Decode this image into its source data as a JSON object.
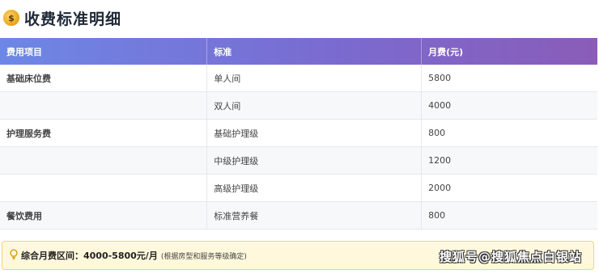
{
  "header": {
    "icon": "money-bag-icon",
    "icon_glyph": "$",
    "title": "收费标准明细"
  },
  "table": {
    "columns": [
      "费用项目",
      "标准",
      "月费(元)"
    ],
    "rows": [
      {
        "category": "基础床位费",
        "standard": "单人间",
        "fee": "5800"
      },
      {
        "category": "",
        "standard": "双人间",
        "fee": "4000"
      },
      {
        "category": "护理服务费",
        "standard": "基础护理级",
        "fee": "800"
      },
      {
        "category": "",
        "standard": "中级护理级",
        "fee": "1200"
      },
      {
        "category": "",
        "standard": "高级护理级",
        "fee": "2000"
      },
      {
        "category": "餐饮费用",
        "standard": "标准营养餐",
        "fee": "800"
      }
    ]
  },
  "summary": {
    "icon": "lightbulb-icon",
    "label": "综合月费区间：4000-5800元/月",
    "note": "(根据房型和服务等级确定)",
    "watermark": "搜狐号@搜狐焦点白银站"
  },
  "colors": {
    "header_gradient_start": "#6d87e6",
    "header_gradient_end": "#8a5cb8",
    "summary_bg": "#fff8dc",
    "summary_border": "#f3d56b"
  }
}
